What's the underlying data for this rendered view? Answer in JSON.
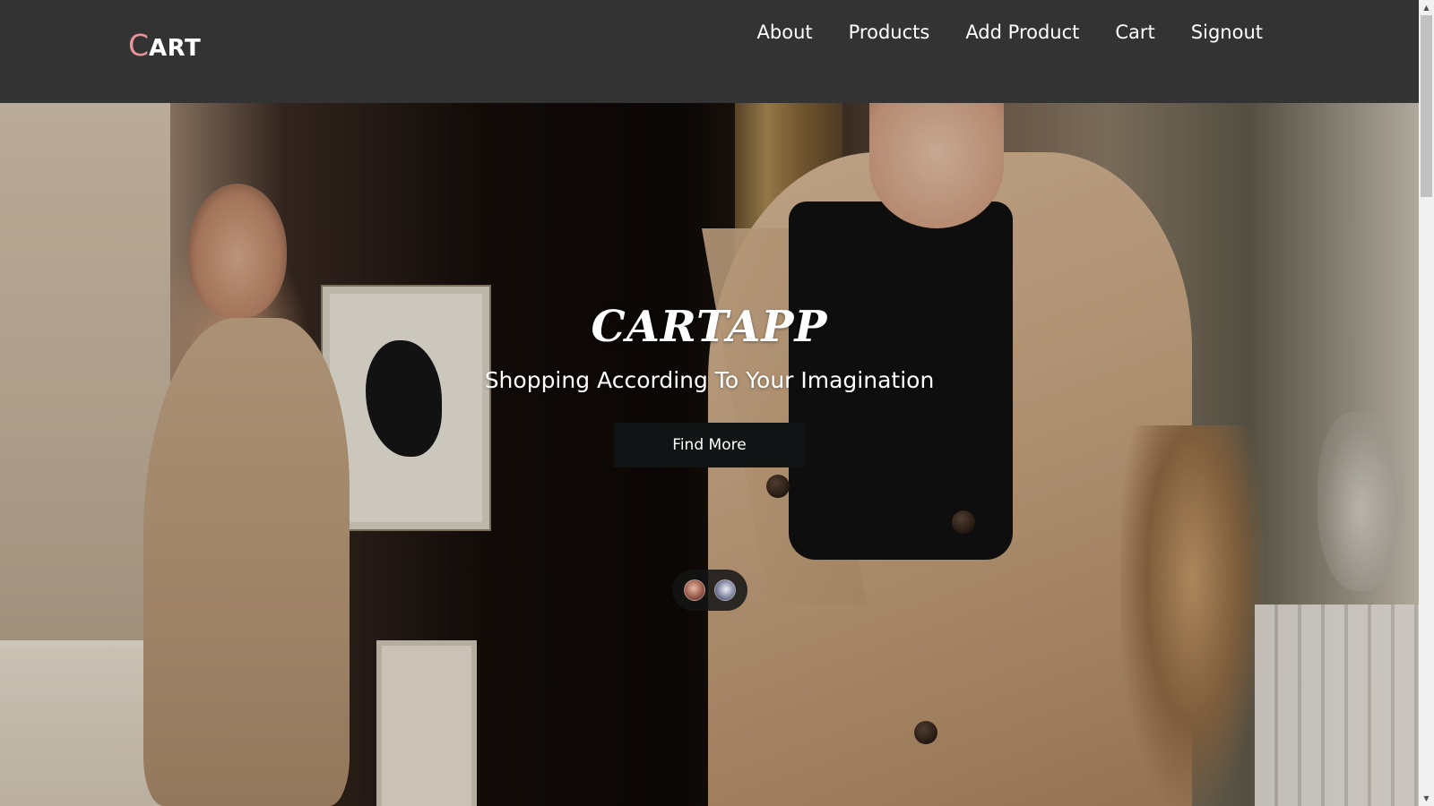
{
  "brand": {
    "initial": "C",
    "rest": "ART",
    "accent_color": "#e8929a"
  },
  "nav": {
    "items": [
      {
        "label": "About"
      },
      {
        "label": "Products"
      },
      {
        "label": "Add Product"
      },
      {
        "label": "Cart"
      },
      {
        "label": "Signout"
      }
    ]
  },
  "hero": {
    "title": "CARTAPP",
    "subtitle": "Shopping According To Your Imagination",
    "cta_label": "Find More",
    "carousel": {
      "slide_count": 2,
      "thumbnails": [
        "person-thumbnail",
        "person-thumbnail"
      ]
    }
  },
  "theme": {
    "navbar_bg": "#333333",
    "button_bg": "#111414",
    "text_color": "#ffffff"
  },
  "scrollbar": {
    "up_icon": "chevron-up-icon",
    "down_icon": "chevron-down-icon"
  }
}
